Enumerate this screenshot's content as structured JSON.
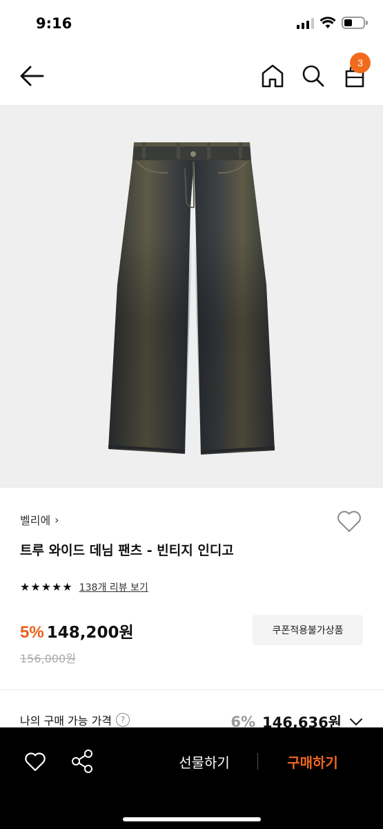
{
  "status_bar": {
    "time": "9:16"
  },
  "header": {
    "cart_count": "3",
    "back_icon": "arrow-left-icon",
    "home_icon": "home-icon",
    "search_icon": "search-icon",
    "cart_icon": "shopping-bag-icon"
  },
  "product": {
    "brand": "벨리에",
    "brand_chevron": "›",
    "title": "트루 와이드 데님 팬츠 - 빈티지 인디고",
    "rating_stars": 5,
    "review_link": "138개 리뷰 보기",
    "discount_rate": "5%",
    "sale_price": "148,200원",
    "original_price": "156,000원",
    "coupon_label": "쿠폰적용불가상품"
  },
  "my_price": {
    "label": "나의 구매 가능 가격",
    "help": "?",
    "discount_rate": "6%",
    "price": "146,636원"
  },
  "bottom_bar": {
    "gift_label": "선물하기",
    "buy_label": "구매하기"
  },
  "colors": {
    "accent": "#f26b1d",
    "image_bg": "#efefef",
    "denim": "#3d4146",
    "denim_fade": "#6a6346"
  }
}
